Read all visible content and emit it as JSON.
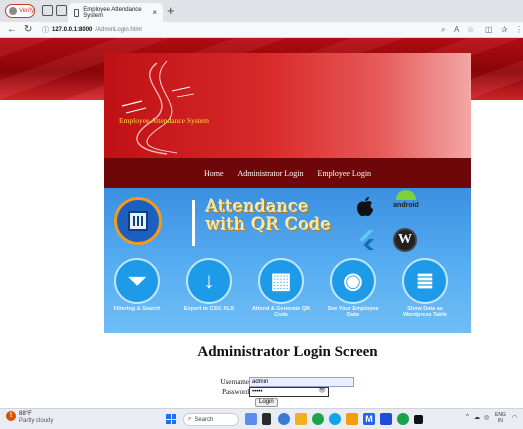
{
  "browser": {
    "profile_label": "Verify",
    "tab_title": "Employee Attendance System",
    "tab_close": "×",
    "new_tab": "+",
    "url_host": "127.0.0.1:8000",
    "url_path": "/AdminLogin.html"
  },
  "site": {
    "title": "Employee Attendance System",
    "nav": [
      "Home",
      "Administrator Login",
      "Employee Login"
    ]
  },
  "banner": {
    "headline_line1": "Attendance",
    "headline_line2": "with QR Code",
    "android_label": "android",
    "features": [
      {
        "caption": "Filtering & Search",
        "icon": "funnel-icon"
      },
      {
        "caption": "Export to CSV, XLS",
        "icon": "download-icon"
      },
      {
        "caption": "Attend & Generate QR Code",
        "icon": "qr-icon"
      },
      {
        "caption": "See Your Employee Data",
        "icon": "eye-icon"
      },
      {
        "caption": "Show Data as Wordpress Table",
        "icon": "database-icon"
      }
    ]
  },
  "login": {
    "heading": "Administrator Login Screen",
    "username_label": "Username",
    "username_value": "admin",
    "password_label": "Password",
    "password_value": "•••••",
    "button_label": "Login"
  },
  "taskbar": {
    "weather_temp": "88°F",
    "weather_desc": "Partly cloudy",
    "search_label": "Search",
    "lang_line1": "ENG",
    "lang_line2": "IN"
  },
  "colors": {
    "header_red": "#bf1015",
    "nav_dark_red": "#6d0709",
    "title_yellow": "#f5e23a",
    "banner_blue": "#3b8fe0"
  }
}
